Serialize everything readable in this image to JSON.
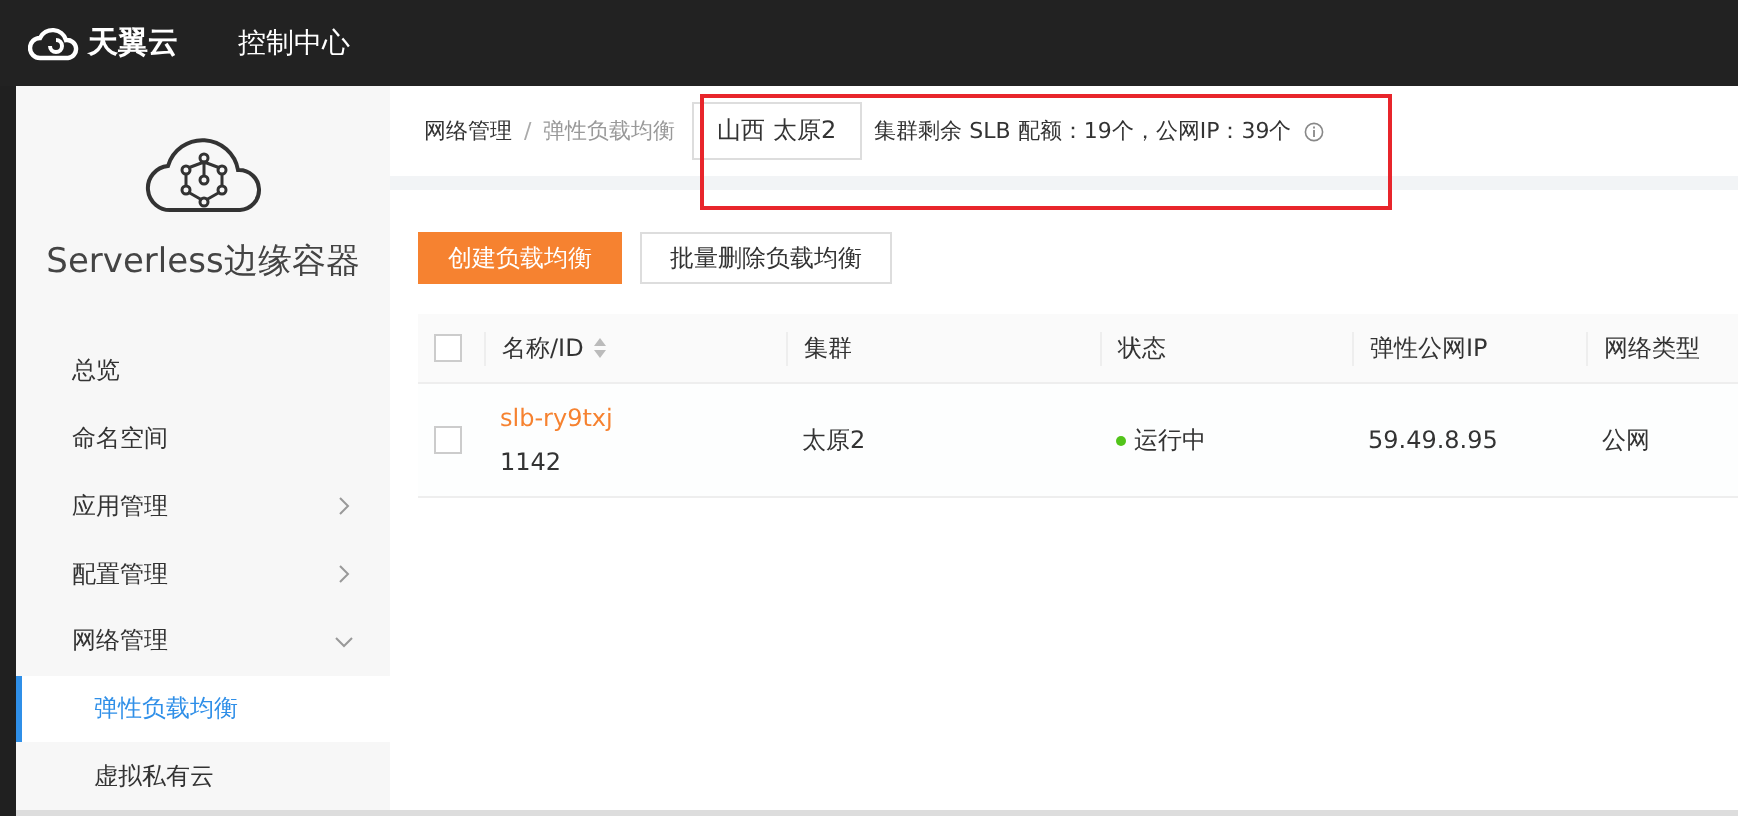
{
  "topbar": {
    "brand": "天翼云",
    "title": "控制中心"
  },
  "sidebar": {
    "product": "Serverless边缘容器",
    "items": [
      {
        "label": "总览",
        "kind": "plain",
        "selected": false
      },
      {
        "label": "命名空间",
        "kind": "plain",
        "selected": false
      },
      {
        "label": "应用管理",
        "kind": "group",
        "expanded": false,
        "selected": false
      },
      {
        "label": "配置管理",
        "kind": "group",
        "expanded": false,
        "selected": false
      },
      {
        "label": "网络管理",
        "kind": "group",
        "expanded": true,
        "selected": false,
        "children": [
          {
            "label": "弹性负载均衡",
            "selected": true
          },
          {
            "label": "虚拟私有云",
            "selected": false
          }
        ]
      }
    ]
  },
  "breadcrumb": [
    "网络管理",
    "弹性负载均衡"
  ],
  "breadcrumb_separator": "/",
  "region": "山西  太原2",
  "quota": "集群剩余 SLB 配额：19个，公网IP：39个",
  "buttons": [
    {
      "label": "创建负载均衡",
      "kind": "primary"
    },
    {
      "label": "批量删除负载均衡",
      "kind": "default"
    }
  ],
  "table": {
    "select_all_checked": false,
    "columns": [
      "名称/ID",
      "集群",
      "状态",
      "弹性公网IP",
      "网络类型"
    ],
    "rows": [
      {
        "checked": false,
        "name": "slb-ry9txj",
        "id": "1142",
        "cluster": "太原2",
        "status": "运行中",
        "color": "#52c41a",
        "ip": "59.49.8.95",
        "network": "公网"
      }
    ]
  }
}
